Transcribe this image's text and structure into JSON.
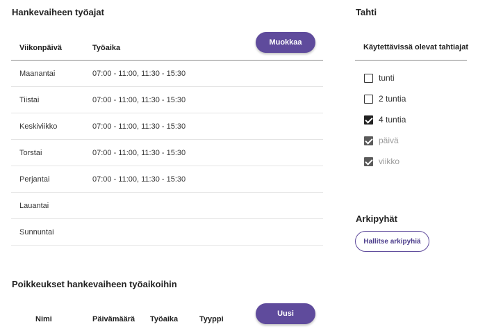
{
  "hours": {
    "title": "Hankevaiheen työajat",
    "edit_label": "Muokkaa",
    "col_day": "Viikonpäivä",
    "col_time": "Työaika",
    "rows": [
      {
        "day": "Maanantai",
        "time": "07:00 - 11:00, 11:30 - 15:30"
      },
      {
        "day": "Tiistai",
        "time": "07:00 - 11:00, 11:30 - 15:30"
      },
      {
        "day": "Keskiviikko",
        "time": "07:00 - 11:00, 11:30 - 15:30"
      },
      {
        "day": "Torstai",
        "time": "07:00 - 11:00, 11:30 - 15:30"
      },
      {
        "day": "Perjantai",
        "time": "07:00 - 11:00, 11:30 - 15:30"
      },
      {
        "day": "Lauantai",
        "time": ""
      },
      {
        "day": "Sunnuntai",
        "time": ""
      }
    ]
  },
  "exceptions": {
    "title": "Poikkeukset hankevaiheen työaikoihin",
    "new_label": "Uusi",
    "col_name": "Nimi",
    "col_date": "Päivämäärä",
    "col_time": "Työaika",
    "col_type": "Tyyppi"
  },
  "tahti": {
    "title": "Tahti",
    "subhead": "Käytettävissä olevat tahtiajat",
    "options": [
      {
        "label": "tunti",
        "checked": false,
        "disabled": false
      },
      {
        "label": "2 tuntia",
        "checked": false,
        "disabled": false
      },
      {
        "label": "4 tuntia",
        "checked": true,
        "disabled": false
      },
      {
        "label": "päivä",
        "checked": true,
        "disabled": true
      },
      {
        "label": "viikko",
        "checked": true,
        "disabled": true
      }
    ]
  },
  "arkipyhat": {
    "title": "Arkipyhät",
    "button_label": "Hallitse arkipyhiä"
  }
}
